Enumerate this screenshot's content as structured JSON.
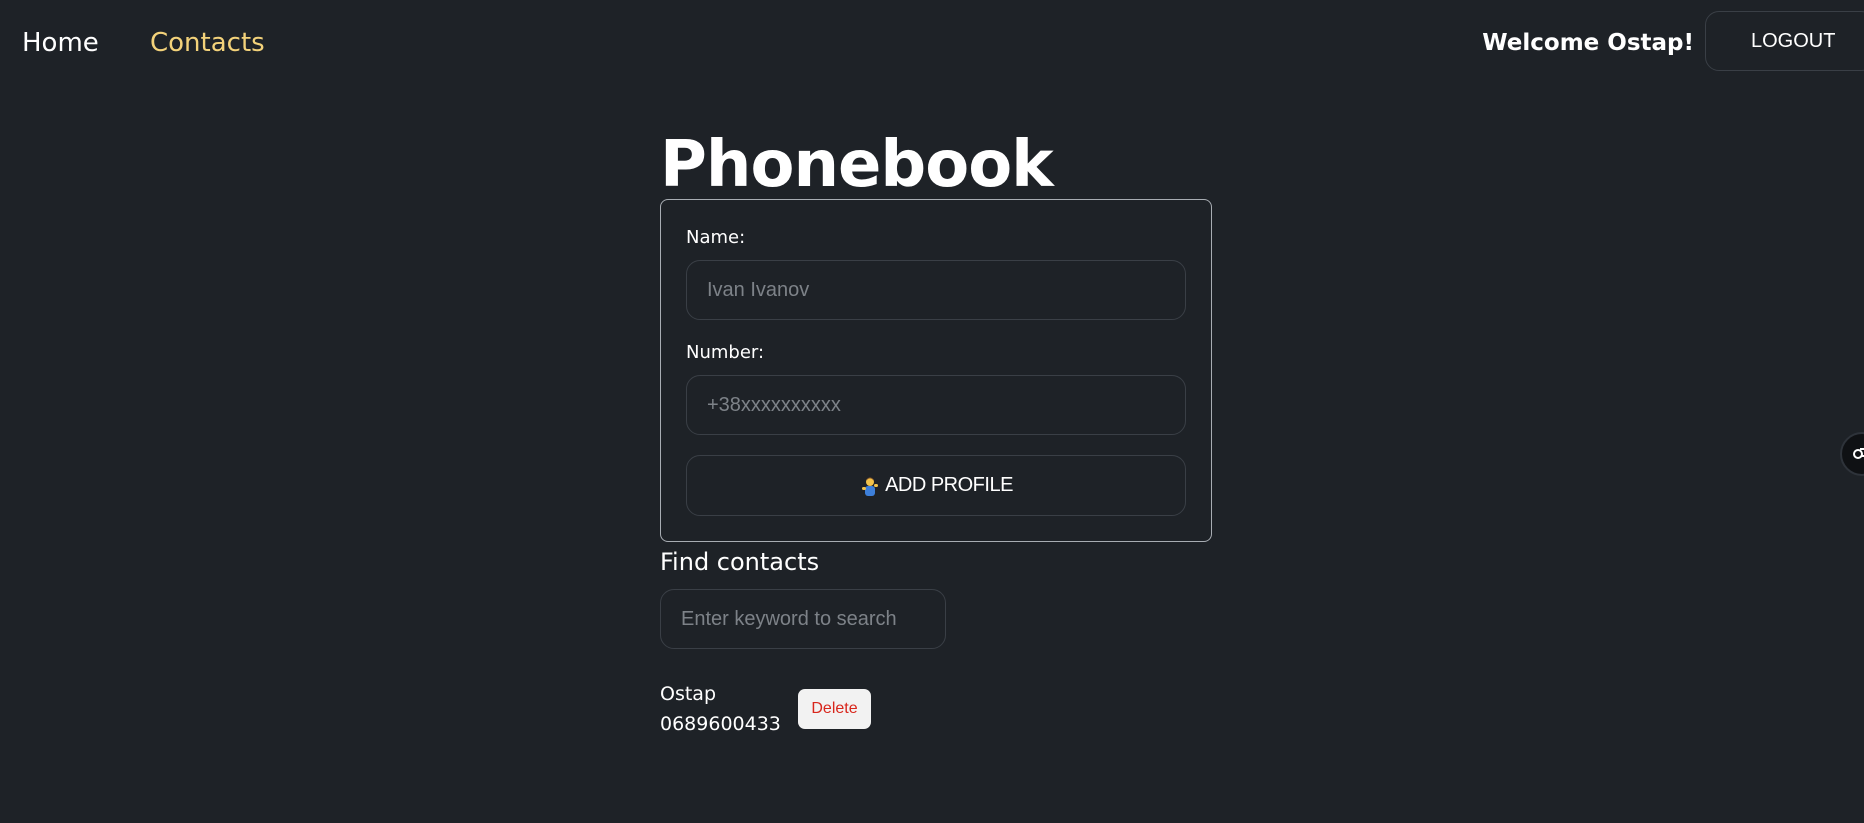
{
  "nav": {
    "home_label": "Home",
    "contacts_label": "Contacts",
    "welcome_text": "Welcome Ostap!",
    "logout_label": "LOGOUT",
    "active_color": "#f3d27a"
  },
  "main": {
    "title": "Phonebook",
    "form": {
      "name_label": "Name:",
      "name_placeholder": "Ivan Ivanov",
      "name_value": "",
      "number_label": "Number:",
      "number_placeholder": "+38xxxxxxxxxx",
      "number_value": "",
      "add_button_label": "ADD PROFILE",
      "add_button_icon": "person-tipping-hand-icon"
    },
    "search": {
      "title": "Find contacts",
      "placeholder": "Enter keyword to search",
      "value": ""
    },
    "contacts": [
      {
        "name": "Ostap",
        "number": "0689600433",
        "delete_label": "Delete"
      }
    ]
  },
  "colors": {
    "background": "#1e2227",
    "delete_text": "#d8261c"
  }
}
